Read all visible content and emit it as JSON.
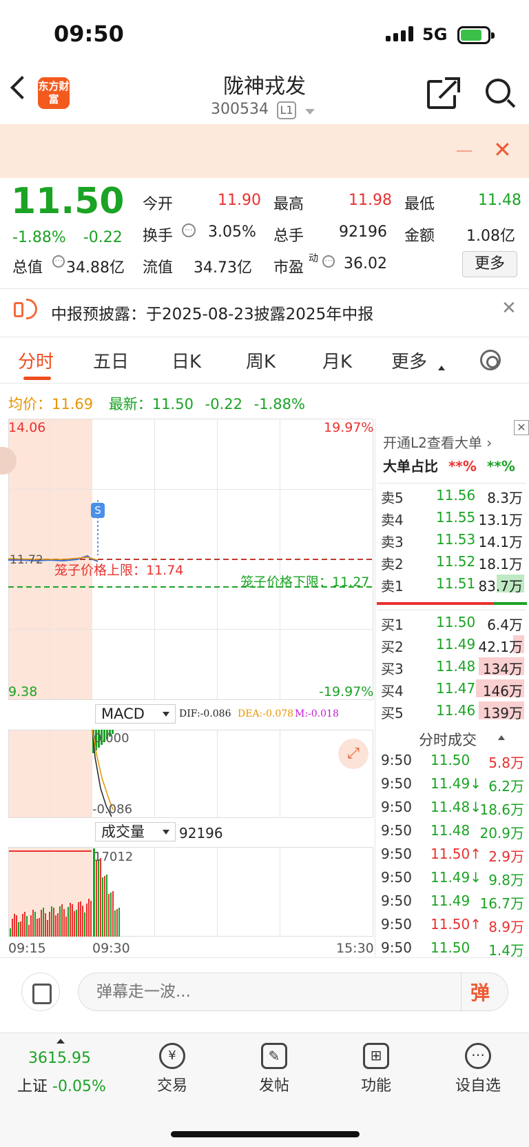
{
  "status_bar": {
    "time": "09:50",
    "network": "5G"
  },
  "header": {
    "logo": "东方财富",
    "title": "陇神戎发",
    "code": "300534",
    "level": "L1"
  },
  "quote": {
    "price": "11.50",
    "pct": "-1.88%",
    "chg": "-0.22",
    "open_label": "今开",
    "open": "11.90",
    "high_label": "最高",
    "high": "11.98",
    "low_label": "最低",
    "low": "11.48",
    "turnover_label": "换手",
    "turnover": "3.05%",
    "volume_label": "总手",
    "volume": "92196",
    "amount_label": "金额",
    "amount": "1.08亿",
    "mktcap_label": "总值",
    "mktcap": "34.88亿",
    "float_label": "流值",
    "float": "34.73亿",
    "pe_label": "市盈",
    "pe_sup": "动",
    "pe": "36.02",
    "more": "更多"
  },
  "notice": {
    "text": "中报预披露：于2025-08-23披露2025年中报"
  },
  "tabs": [
    "分时",
    "五日",
    "日K",
    "周K",
    "月K",
    "更多"
  ],
  "avg_row": {
    "avg_label": "均价：",
    "avg": "11.69",
    "latest_label": "最新：",
    "latest": "11.50",
    "chg": "-0.22",
    "pct": "-1.88%"
  },
  "chart_data": {
    "type": "line",
    "y_top": "14.06",
    "y_bottom": "9.38",
    "pct_top": "19.97%",
    "pct_bottom": "-19.97%",
    "prev_close": "11.72",
    "upper_limit_label": "笼子价格上限：11.74",
    "lower_limit_label": "笼子价格下限：11.27",
    "signal": "S",
    "x_labels": [
      "09:15",
      "09:30",
      "15:30"
    ]
  },
  "macd": {
    "label": "MACD",
    "dif": "DIF:-0.086",
    "dea": "DEA:-0.078",
    "m": "M:-0.018",
    "top": "0.000",
    "bottom": "-0.086"
  },
  "vol": {
    "label": "成交量",
    "value": "92196",
    "max": "17012"
  },
  "orderbook": {
    "promo": "开通L2查看大单",
    "big_label": "大单占比",
    "big_red": "**%",
    "big_green": "**%",
    "asks": [
      {
        "label": "卖5",
        "price": "11.56",
        "vol": "8.3万"
      },
      {
        "label": "卖4",
        "price": "11.55",
        "vol": "13.1万"
      },
      {
        "label": "卖3",
        "price": "11.53",
        "vol": "14.1万"
      },
      {
        "label": "卖2",
        "price": "11.52",
        "vol": "18.1万"
      },
      {
        "label": "卖1",
        "price": "11.51",
        "vol": "83.7万"
      }
    ],
    "bids": [
      {
        "label": "买1",
        "price": "11.50",
        "vol": "6.4万"
      },
      {
        "label": "买2",
        "price": "11.49",
        "vol": "42.1万"
      },
      {
        "label": "买3",
        "price": "11.48",
        "vol": "134万"
      },
      {
        "label": "买4",
        "price": "11.47",
        "vol": "146万"
      },
      {
        "label": "买5",
        "price": "11.46",
        "vol": "139万"
      }
    ],
    "trades_title": "分时成交",
    "trades": [
      {
        "t": "9:50",
        "p": "11.50",
        "v": "5.8万"
      },
      {
        "t": "9:50",
        "p": "11.49↓",
        "v": "6.2万"
      },
      {
        "t": "9:50",
        "p": "11.48↓",
        "v": "18.6万"
      },
      {
        "t": "9:50",
        "p": "11.48",
        "v": "20.9万"
      },
      {
        "t": "9:50",
        "p": "11.50↑",
        "v": "2.9万"
      },
      {
        "t": "9:50",
        "p": "11.49↓",
        "v": "9.8万"
      },
      {
        "t": "9:50",
        "p": "11.49",
        "v": "16.7万"
      },
      {
        "t": "9:50",
        "p": "11.50↑",
        "v": "8.9万"
      },
      {
        "t": "9:50",
        "p": "11.50",
        "v": "1.4万"
      }
    ]
  },
  "comment": {
    "placeholder": "弹幕走一波...",
    "dan": "弹"
  },
  "bottom_nav": {
    "index_value": "3615.95",
    "index_name": "上证",
    "index_pct": "-0.05%",
    "items": [
      "交易",
      "发帖",
      "功能",
      "设自选"
    ]
  }
}
